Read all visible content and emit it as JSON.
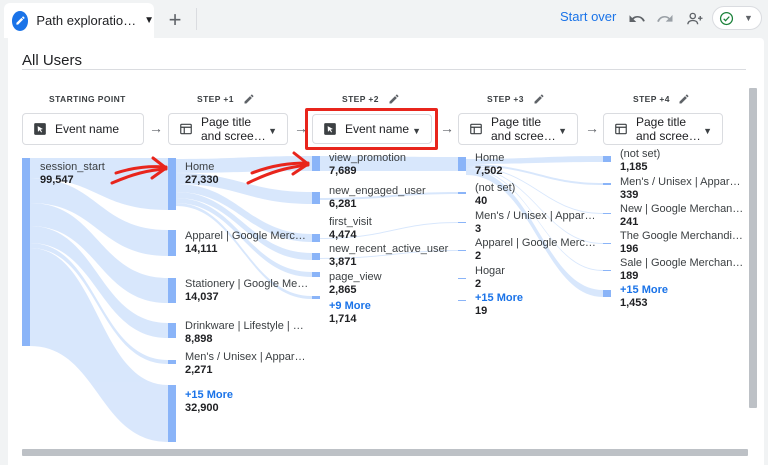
{
  "tab": {
    "title": "Path exploratio…",
    "add": "+"
  },
  "toolbar": {
    "start_over": "Start over"
  },
  "panel": {
    "title": "All Users"
  },
  "steps": [
    {
      "label": "STARTING POINT",
      "selector": "Event name"
    },
    {
      "label": "STEP +1",
      "selector_line1": "Page title",
      "selector_line2": "and scree…"
    },
    {
      "label": "STEP +2",
      "selector": "Event name"
    },
    {
      "label": "STEP +3",
      "selector_line1": "Page title",
      "selector_line2": "and scree…"
    },
    {
      "label": "STEP +4",
      "selector_line1": "Page title",
      "selector_line2": "and scree…"
    }
  ],
  "col0": [
    {
      "name": "session_start",
      "value": "99,547"
    }
  ],
  "col1": [
    {
      "name": "Home",
      "value": "27,330"
    },
    {
      "name": "Apparel | Google Merc…",
      "value": "14,111"
    },
    {
      "name": "Stationery | Google Me…",
      "value": "14,037"
    },
    {
      "name": "Drinkware | Lifestyle | …",
      "value": "8,898"
    },
    {
      "name": "Men's / Unisex | Appar…",
      "value": "2,271"
    },
    {
      "name": "+15 More",
      "value": "32,900"
    }
  ],
  "col2": [
    {
      "name": "view_promotion",
      "value": "7,689"
    },
    {
      "name": "new_engaged_user",
      "value": "6,281"
    },
    {
      "name": "first_visit",
      "value": "4,474"
    },
    {
      "name": "new_recent_active_user",
      "value": "3,871"
    },
    {
      "name": "page_view",
      "value": "2,865"
    },
    {
      "name": "+9 More",
      "value": "1,714"
    }
  ],
  "col3": [
    {
      "name": "Home",
      "value": "7,502"
    },
    {
      "name": "(not set)",
      "value": "40"
    },
    {
      "name": "Men's / Unisex | Appar…",
      "value": "3"
    },
    {
      "name": "Apparel | Google Merc…",
      "value": "2"
    },
    {
      "name": "Hogar",
      "value": "2"
    },
    {
      "name": "+15 More",
      "value": "19"
    }
  ],
  "col4": [
    {
      "name": "(not set)",
      "value": "1,185"
    },
    {
      "name": "Men's / Unisex | Appar…",
      "value": "339"
    },
    {
      "name": "New | Google Merchan…",
      "value": "241"
    },
    {
      "name": "The Google Merchandi…",
      "value": "196"
    },
    {
      "name": "Sale | Google Merchan…",
      "value": "189"
    },
    {
      "name": "+15 More",
      "value": "1,453"
    }
  ],
  "colors": {
    "accent": "#1a73e8",
    "node": "#8ab4f8",
    "flow": "#d2e3fc",
    "highlight": "#e8251c"
  }
}
